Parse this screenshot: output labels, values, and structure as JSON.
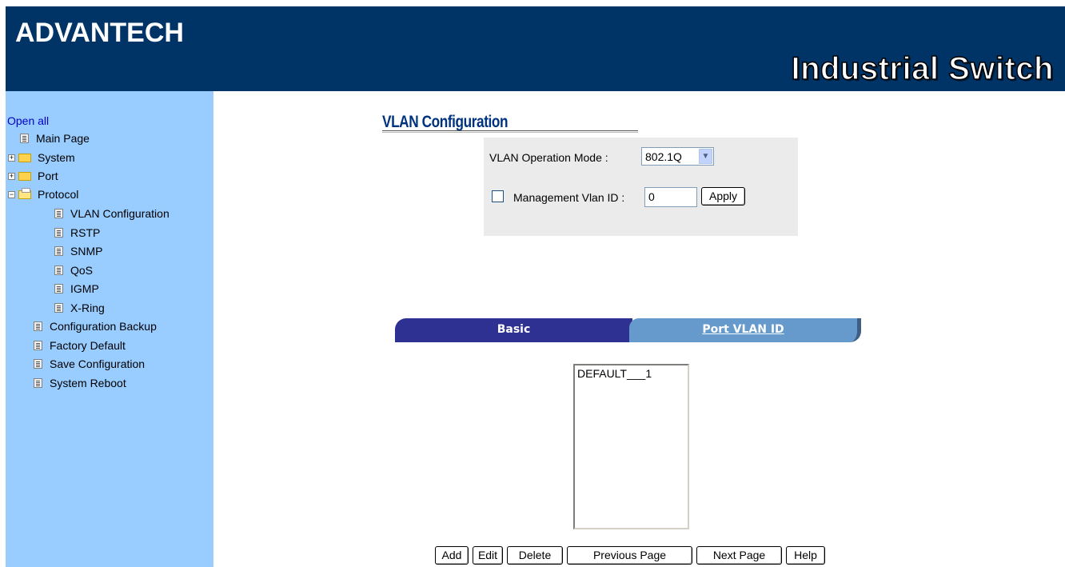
{
  "header": {
    "logo": "ADVANTECH",
    "product_name": "Industrial Switch"
  },
  "sidebar": {
    "open_all": "Open all",
    "items": [
      {
        "label": "Main Page"
      },
      {
        "label": "System"
      },
      {
        "label": "Port"
      },
      {
        "label": "Protocol"
      },
      {
        "label": "VLAN Configuration"
      },
      {
        "label": "RSTP"
      },
      {
        "label": "SNMP"
      },
      {
        "label": "QoS"
      },
      {
        "label": "IGMP"
      },
      {
        "label": "X-Ring"
      },
      {
        "label": "Configuration Backup"
      },
      {
        "label": "Factory Default"
      },
      {
        "label": "Save Configuration"
      },
      {
        "label": "System Reboot"
      }
    ]
  },
  "main": {
    "title": "VLAN Configuration",
    "operation_mode_label": "VLAN Operation Mode :",
    "operation_mode_value": "802.1Q",
    "mgmt_vlan_label": "Management Vlan ID :",
    "mgmt_vlan_value": "0",
    "mgmt_vlan_checked": false,
    "apply_label": "Apply",
    "tabs": [
      {
        "label": "Basic",
        "active": true
      },
      {
        "label": "Port VLAN ID",
        "active": false
      }
    ],
    "vlan_list": [
      "DEFAULT___1"
    ],
    "buttons": {
      "add": "Add",
      "edit": "Edit",
      "delete": "Delete",
      "previous_page": "Previous Page",
      "next_page": "Next Page",
      "help": "Help"
    }
  },
  "colors": {
    "header_bg": "#003366",
    "sidebar_bg": "#99ccff",
    "tab_active": "#2e3192",
    "tab_inactive": "#6699cc",
    "title_color": "#00337f"
  }
}
